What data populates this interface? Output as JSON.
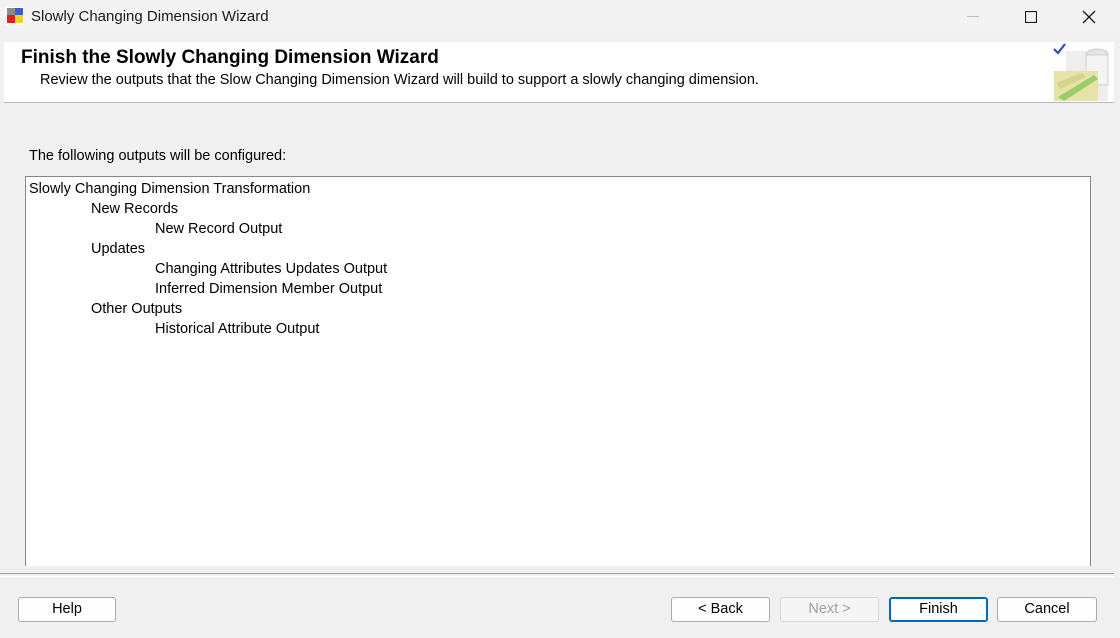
{
  "window": {
    "title": "Slowly Changing Dimension Wizard",
    "icon": "ssis-wizard-icon"
  },
  "header": {
    "title": "Finish the Slowly Changing Dimension Wizard",
    "subtitle": "Review the outputs that the Slow Changing Dimension Wizard will build to support a slowly changing dimension.",
    "graphic": "wizard-checkmark-graphic"
  },
  "main": {
    "label": "The following outputs will be configured:",
    "tree": {
      "root": "Slowly Changing Dimension Transformation",
      "groups": [
        {
          "label": "New Records",
          "items": [
            "New Record Output"
          ]
        },
        {
          "label": "Updates",
          "items": [
            "Changing Attributes Updates Output",
            "Inferred Dimension Member Output"
          ]
        },
        {
          "label": "Other Outputs",
          "items": [
            "Historical Attribute Output"
          ]
        }
      ]
    }
  },
  "buttons": {
    "help": "Help",
    "back": "< Back",
    "next": "Next >",
    "finish": "Finish",
    "cancel": "Cancel"
  },
  "colors": {
    "accent": "#0067c0",
    "background": "#f0f0f0",
    "disabled_text": "#a0a0a0"
  }
}
